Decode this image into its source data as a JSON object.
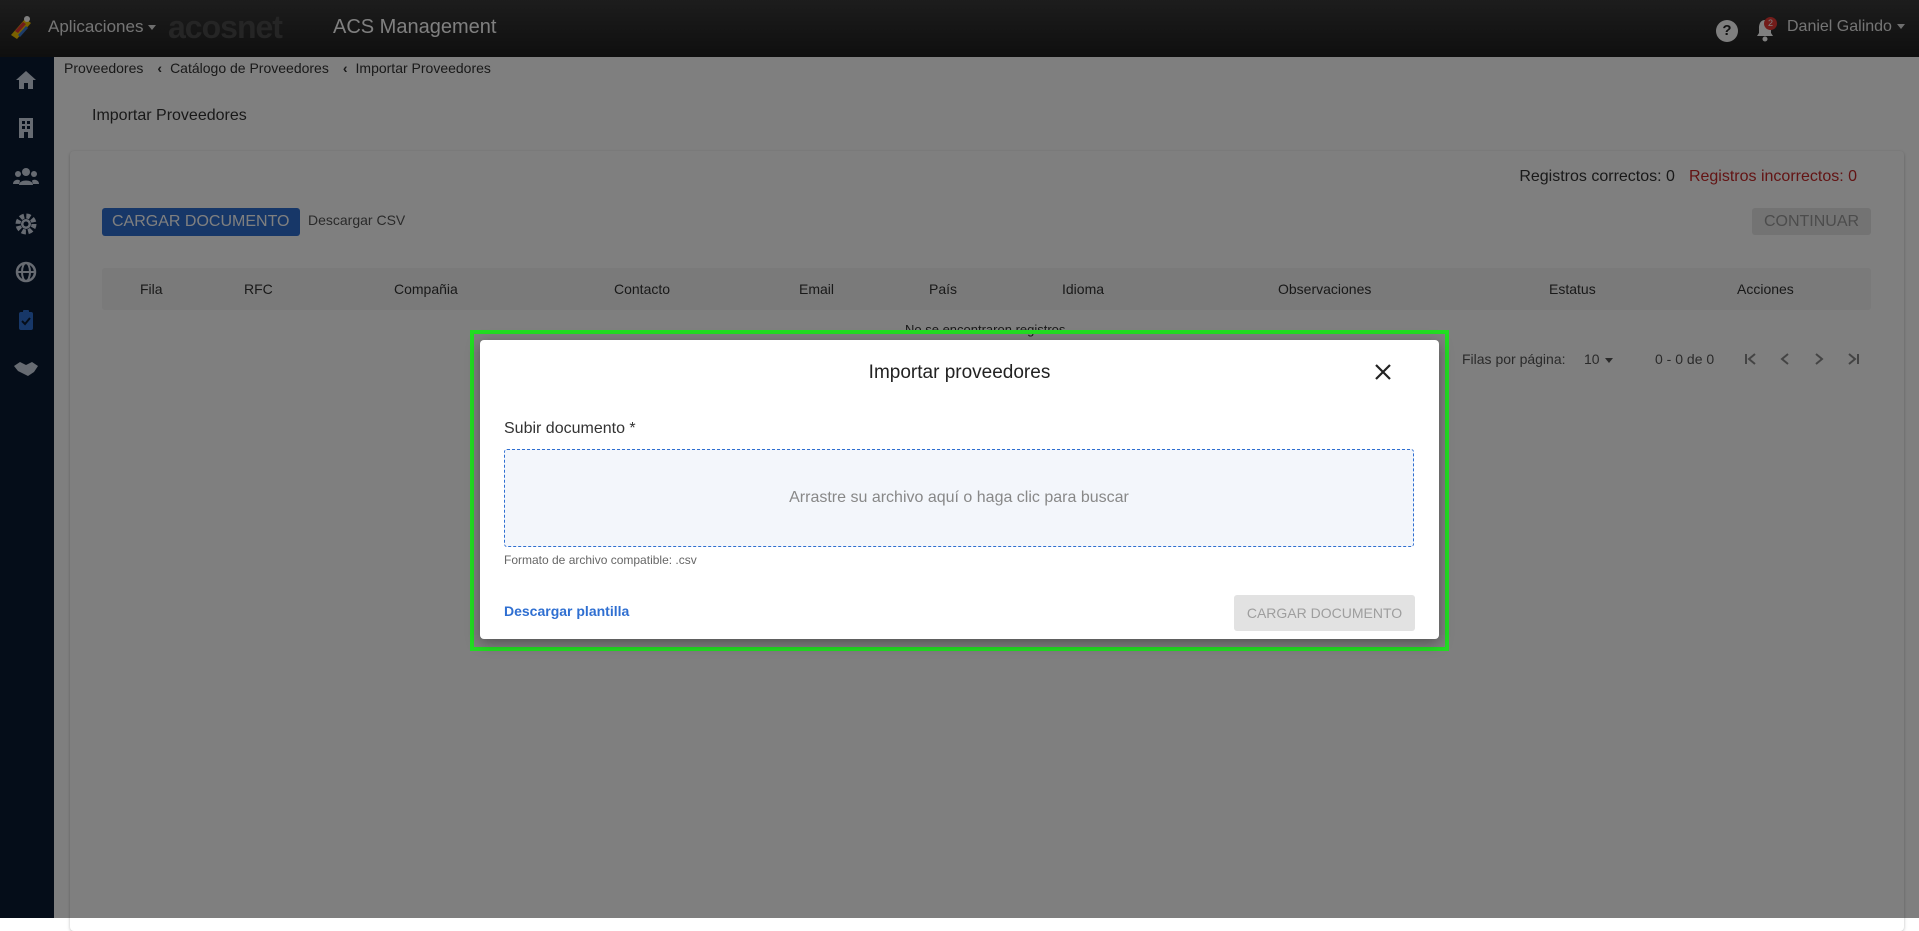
{
  "header": {
    "apps_label": "Aplicaciones",
    "brand": "acosnet",
    "title": "ACS Management",
    "help_glyph": "?",
    "notifications_count": "2",
    "user_name": "Daniel Galindo"
  },
  "sidebar": {
    "items": [
      {
        "icon": "home-icon"
      },
      {
        "icon": "building-icon"
      },
      {
        "icon": "users-icon"
      },
      {
        "icon": "gear-icon"
      },
      {
        "icon": "globe-icon"
      },
      {
        "icon": "clipboard-check-icon",
        "active": true
      },
      {
        "icon": "handshake-icon"
      }
    ]
  },
  "breadcrumb": {
    "items": [
      "Proveedores",
      "Catálogo de Proveedores",
      "Importar Proveedores"
    ]
  },
  "page": {
    "title": "Importar Proveedores",
    "correct_records": "Registros correctos: 0",
    "incorrect_records": "Registros incorrectos: 0",
    "upload_button": "CARGAR DOCUMENTO",
    "download_csv": "Descargar CSV",
    "continue_button": "CONTINUAR",
    "columns": [
      "Fila",
      "RFC",
      "Compañia",
      "Contacto",
      "Email",
      "País",
      "Idioma",
      "Observaciones",
      "Estatus",
      "Acciones"
    ],
    "empty_message": "No se encontraron registros",
    "rows_per_page_label": "Filas por página:",
    "rows_per_page": "10",
    "range": "0 - 0 de 0"
  },
  "modal": {
    "title": "Importar proveedores",
    "field_label": "Subir documento *",
    "dropzone_text": "Arrastre su archivo aquí o haga clic para buscar",
    "hint": "Formato de archivo compatible: .csv",
    "download_template": "Descargar plantilla",
    "upload_button": "CARGAR DOCUMENTO"
  },
  "colors": {
    "primary": "#2f6fd1",
    "error": "#c62828",
    "sidebar": "#0b1a33",
    "highlight": "#22dd22"
  }
}
